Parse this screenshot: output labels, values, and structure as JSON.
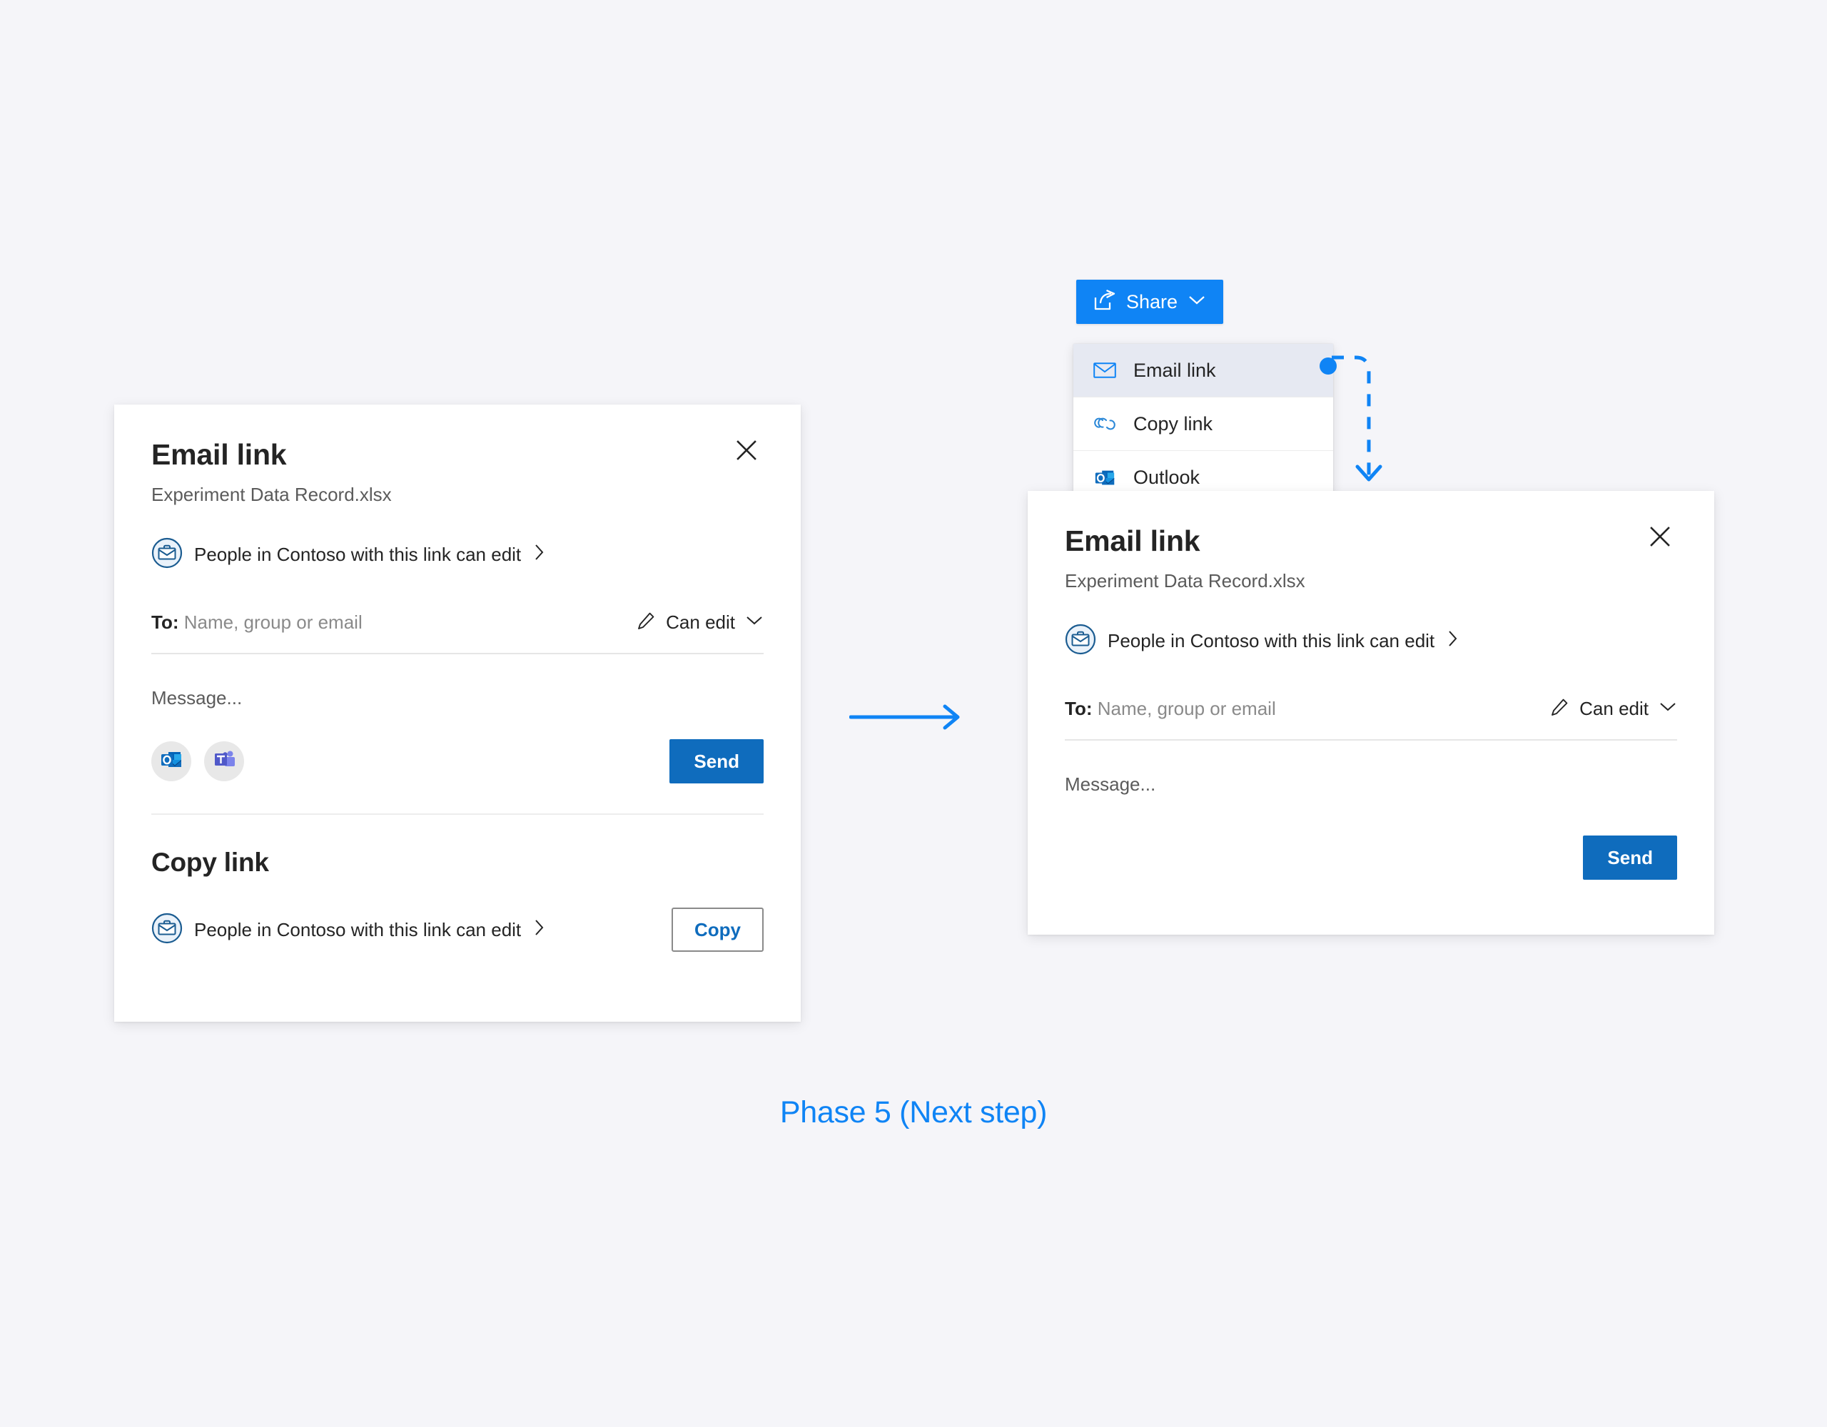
{
  "colors": {
    "canvas_background": "#f5f5f9",
    "accent_blue": "#0f84f5",
    "primary_button": "#0f6cbd",
    "link_blue": "#0f6cbd",
    "menu_selected": "#e6e9f2",
    "text_primary": "#242424",
    "text_secondary": "#5b5b5b",
    "placeholder": "#8a8a8a"
  },
  "share_button": {
    "label": "Share",
    "icon": "share-icon",
    "chevron": "chevron-down-icon"
  },
  "share_menu": {
    "items": [
      {
        "label": "Email link",
        "icon": "envelope-icon",
        "selected": true
      },
      {
        "label": "Copy link",
        "icon": "link-chain-icon",
        "selected": false
      },
      {
        "label": "Outlook",
        "icon": "outlook-icon",
        "selected": false
      }
    ]
  },
  "left_card": {
    "title": "Email link",
    "subtitle": "Experiment Data Record.xlsx",
    "close_icon": "close-icon",
    "permission": {
      "icon": "briefcase-people-icon",
      "text": "People in Contoso with this link can edit",
      "chevron": "chevron-right-icon"
    },
    "to_field": {
      "label": "To:",
      "placeholder": "Name, group or email"
    },
    "permission_select": {
      "icon": "pencil-icon",
      "label": "Can edit",
      "chevron": "chevron-down-icon"
    },
    "message_placeholder": "Message...",
    "app_shortcuts": [
      {
        "name": "outlook-icon",
        "label": "Outlook"
      },
      {
        "name": "teams-icon",
        "label": "Teams"
      }
    ],
    "send_label": "Send",
    "copy_section": {
      "title": "Copy link",
      "permission": {
        "icon": "briefcase-people-icon",
        "text": "People in Contoso with this link can edit",
        "chevron": "chevron-right-icon"
      },
      "copy_label": "Copy"
    }
  },
  "right_card": {
    "title": "Email link",
    "subtitle": "Experiment Data Record.xlsx",
    "close_icon": "close-icon",
    "permission": {
      "icon": "briefcase-people-icon",
      "text": "People in Contoso with this link can edit",
      "chevron": "chevron-right-icon"
    },
    "to_field": {
      "label": "To:",
      "placeholder": "Name, group or email"
    },
    "permission_select": {
      "icon": "pencil-icon",
      "label": "Can edit",
      "chevron": "chevron-down-icon"
    },
    "message_placeholder": "Message...",
    "send_label": "Send"
  },
  "connectors": {
    "straight_arrow": "arrow-right-icon",
    "dashed_arrow": "dashed-arrow-down-icon",
    "anchor_dot": "anchor-dot"
  },
  "caption": {
    "text": "Phase 5 (Next step)"
  }
}
